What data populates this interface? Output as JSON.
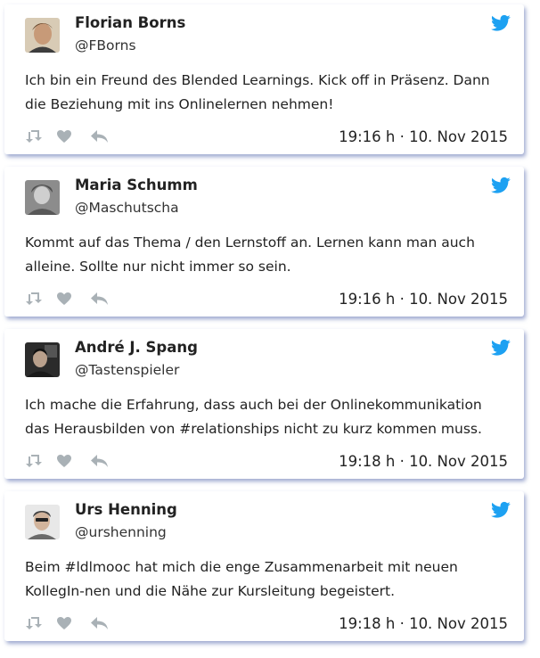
{
  "tweets": [
    {
      "name": "Florian Borns",
      "handle": "@FBorns",
      "text": "Ich bin ein Freund des Blended Learnings. Kick off in Präsenz. Dann die Beziehung mit ins Onlinelernen nehmen!",
      "timestamp": "19:16 h · 10. Nov 2015",
      "avatar_color": "#8a6a4a"
    },
    {
      "name": "Maria Schumm",
      "handle": "@Maschutscha",
      "text": "Kommt auf das Thema / den Lernstoff an. Lernen kann man auch alleine. Sollte nur nicht immer so sein.",
      "timestamp": "19:16 h · 10. Nov 2015",
      "avatar_color": "#7a7a7a"
    },
    {
      "name": "André J. Spang",
      "handle": "@Tastenspieler",
      "text": "Ich mache die Erfahrung, dass auch bei der Onlinekommunikation das Herausbilden von #relationships nicht zu kurz kommen muss.",
      "timestamp": "19:18 h · 10. Nov 2015",
      "avatar_color": "#3a3a3a"
    },
    {
      "name": "Urs Henning",
      "handle": "@urshenning",
      "text": "Beim #ldlmooc hat mich die enge Zusammenarbeit mit neuen KollegIn-nen und die Nähe zur Kursleitung begeistert.",
      "timestamp": "19:18 h · 10. Nov 2015",
      "avatar_color": "#c9c9c9"
    }
  ],
  "colors": {
    "twitter_blue": "#1da1f2",
    "icon_gray": "#a9b1b6",
    "shadow": "#5064aa"
  },
  "icons": [
    "twitter-bird-icon",
    "retweet-icon",
    "like-icon",
    "reply-icon"
  ]
}
